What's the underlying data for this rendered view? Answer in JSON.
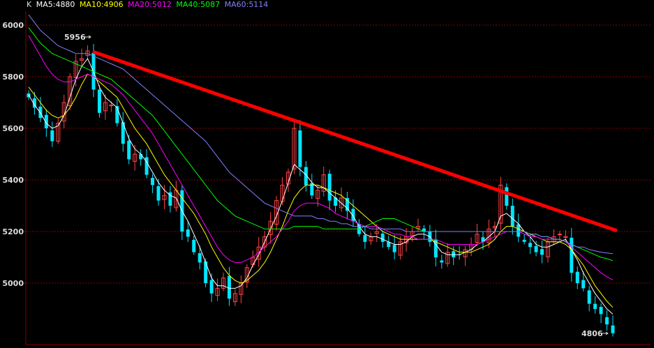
{
  "chart_data": {
    "type": "candlestick",
    "title": "K",
    "legend_position": "top-left",
    "grid": true,
    "ylim": [
      4750,
      6120
    ],
    "y_ticks": [
      5000,
      5200,
      5400,
      5600,
      5800,
      6000
    ],
    "y_tick_labels": [
      "5000",
      "5200",
      "5400",
      "5600",
      "5800",
      "6000"
    ],
    "moving_averages": [
      {
        "name": "MA5",
        "label": "MA5:4880",
        "value": 4880,
        "color": "#ffffff"
      },
      {
        "name": "MA10",
        "label": "MA10:4906",
        "value": 4906,
        "color": "#ffff00"
      },
      {
        "name": "MA20",
        "label": "MA20:5012",
        "value": 5012,
        "color": "#ff00ff"
      },
      {
        "name": "MA40",
        "label": "MA40:5087",
        "value": 5087,
        "color": "#00ff00"
      },
      {
        "name": "MA60",
        "label": "MA60:5114",
        "value": 5114,
        "color": "#8080ff"
      }
    ],
    "annotations": [
      {
        "label": "5956",
        "value": 5956,
        "arrow": "right"
      },
      {
        "label": "4806",
        "value": 4806,
        "arrow": "right"
      }
    ],
    "trendline": {
      "color": "#ff0000",
      "from_value": 5895,
      "to_value": 5205
    },
    "colors": {
      "up": "#ff4444",
      "down": "#00e5ff",
      "grid": "#8b0000",
      "axis": "#8b0000",
      "text": "#dddddd",
      "trend": "#ff0000"
    },
    "close_path": [
      5720,
      5680,
      5640,
      5600,
      5550,
      5620,
      5700,
      5800,
      5860,
      5870,
      5900,
      5750,
      5660,
      5700,
      5690,
      5620,
      5540,
      5480,
      5500,
      5480,
      5420,
      5380,
      5320,
      5340,
      5300,
      5360,
      5200,
      5180,
      5120,
      5080,
      5000,
      4960,
      4980,
      5020,
      4940,
      4960,
      5000,
      5060,
      5100,
      5140,
      5180,
      5240,
      5320,
      5380,
      5430,
      5600,
      5450,
      5380,
      5340,
      5360,
      5420,
      5320,
      5300,
      5330,
      5280,
      5240,
      5190,
      5160,
      5180,
      5200,
      5160,
      5140,
      5120,
      5160,
      5180,
      5200,
      5220,
      5200,
      5160,
      5100,
      5080,
      5120,
      5100,
      5110,
      5130,
      5150,
      5190,
      5160,
      5210,
      5220,
      5380,
      5300,
      5220,
      5180,
      5160,
      5140,
      5120,
      5110,
      5160,
      5180,
      5190,
      5180,
      5040,
      5000,
      4980,
      4920,
      4900,
      4880,
      4840,
      4806
    ],
    "ma5_path": [
      5730,
      5690,
      5660,
      5620,
      5600,
      5610,
      5650,
      5720,
      5790,
      5840,
      5870,
      5820,
      5760,
      5720,
      5700,
      5680,
      5620,
      5560,
      5520,
      5500,
      5470,
      5430,
      5390,
      5360,
      5340,
      5330,
      5280,
      5240,
      5190,
      5140,
      5080,
      5020,
      4990,
      4990,
      4980,
      4980,
      4990,
      5020,
      5070,
      5110,
      5160,
      5210,
      5260,
      5320,
      5390,
      5460,
      5440,
      5420,
      5390,
      5370,
      5370,
      5350,
      5330,
      5310,
      5290,
      5260,
      5220,
      5190,
      5180,
      5180,
      5170,
      5160,
      5150,
      5150,
      5160,
      5180,
      5190,
      5190,
      5180,
      5150,
      5120,
      5110,
      5110,
      5110,
      5120,
      5130,
      5150,
      5160,
      5180,
      5200,
      5260,
      5270,
      5250,
      5230,
      5200,
      5180,
      5150,
      5140,
      5140,
      5150,
      5160,
      5170,
      5130,
      5090,
      5040,
      5000,
      4960,
      4930,
      4900,
      4880
    ],
    "ma10_path": [
      5760,
      5730,
      5700,
      5670,
      5650,
      5640,
      5650,
      5680,
      5720,
      5770,
      5810,
      5800,
      5780,
      5760,
      5740,
      5720,
      5680,
      5640,
      5600,
      5570,
      5540,
      5500,
      5460,
      5420,
      5390,
      5360,
      5330,
      5300,
      5270,
      5230,
      5190,
      5140,
      5100,
      5060,
      5030,
      5010,
      5000,
      5010,
      5030,
      5050,
      5080,
      5120,
      5170,
      5220,
      5280,
      5330,
      5360,
      5380,
      5380,
      5380,
      5370,
      5360,
      5350,
      5340,
      5320,
      5300,
      5280,
      5260,
      5240,
      5220,
      5200,
      5190,
      5180,
      5170,
      5170,
      5170,
      5170,
      5170,
      5170,
      5160,
      5150,
      5140,
      5130,
      5120,
      5120,
      5120,
      5130,
      5140,
      5150,
      5170,
      5200,
      5220,
      5220,
      5210,
      5200,
      5190,
      5180,
      5170,
      5160,
      5160,
      5160,
      5150,
      5130,
      5100,
      5070,
      5030,
      4990,
      4960,
      4930,
      4906
    ],
    "ma20_path": [
      5960,
      5920,
      5880,
      5840,
      5810,
      5790,
      5780,
      5780,
      5790,
      5800,
      5810,
      5800,
      5790,
      5780,
      5770,
      5750,
      5730,
      5700,
      5670,
      5640,
      5610,
      5580,
      5540,
      5500,
      5460,
      5420,
      5380,
      5340,
      5300,
      5260,
      5220,
      5180,
      5140,
      5110,
      5090,
      5080,
      5080,
      5090,
      5100,
      5120,
      5140,
      5160,
      5180,
      5210,
      5240,
      5280,
      5300,
      5310,
      5310,
      5310,
      5300,
      5290,
      5270,
      5260,
      5250,
      5240,
      5230,
      5220,
      5220,
      5220,
      5210,
      5200,
      5190,
      5190,
      5180,
      5180,
      5170,
      5170,
      5170,
      5170,
      5160,
      5150,
      5150,
      5150,
      5150,
      5150,
      5150,
      5160,
      5170,
      5180,
      5190,
      5200,
      5200,
      5200,
      5190,
      5180,
      5180,
      5170,
      5170,
      5170,
      5170,
      5160,
      5140,
      5120,
      5100,
      5080,
      5060,
      5040,
      5025,
      5012
    ],
    "ma40_path": [
      5990,
      5960,
      5930,
      5910,
      5890,
      5880,
      5870,
      5860,
      5850,
      5840,
      5830,
      5820,
      5810,
      5800,
      5790,
      5770,
      5750,
      5730,
      5710,
      5690,
      5670,
      5650,
      5620,
      5590,
      5560,
      5530,
      5500,
      5470,
      5440,
      5410,
      5380,
      5350,
      5320,
      5300,
      5280,
      5260,
      5250,
      5240,
      5230,
      5220,
      5210,
      5210,
      5210,
      5210,
      5210,
      5220,
      5220,
      5220,
      5220,
      5220,
      5210,
      5210,
      5210,
      5210,
      5210,
      5210,
      5210,
      5220,
      5230,
      5240,
      5250,
      5250,
      5250,
      5240,
      5230,
      5220,
      5210,
      5200,
      5200,
      5200,
      5200,
      5200,
      5200,
      5200,
      5200,
      5200,
      5200,
      5200,
      5200,
      5200,
      5200,
      5200,
      5200,
      5200,
      5200,
      5190,
      5190,
      5180,
      5180,
      5170,
      5170,
      5160,
      5150,
      5140,
      5130,
      5120,
      5110,
      5100,
      5095,
      5087
    ],
    "ma60_path": [
      6040,
      6010,
      5980,
      5960,
      5940,
      5920,
      5910,
      5900,
      5890,
      5890,
      5890,
      5880,
      5870,
      5860,
      5850,
      5840,
      5830,
      5810,
      5790,
      5770,
      5750,
      5730,
      5710,
      5690,
      5670,
      5650,
      5630,
      5610,
      5590,
      5570,
      5550,
      5520,
      5490,
      5460,
      5430,
      5410,
      5390,
      5370,
      5350,
      5330,
      5310,
      5300,
      5290,
      5280,
      5270,
      5260,
      5260,
      5260,
      5260,
      5250,
      5250,
      5240,
      5240,
      5230,
      5230,
      5220,
      5220,
      5220,
      5210,
      5210,
      5210,
      5210,
      5210,
      5210,
      5200,
      5200,
      5200,
      5200,
      5200,
      5200,
      5200,
      5200,
      5200,
      5200,
      5200,
      5200,
      5200,
      5200,
      5200,
      5200,
      5200,
      5200,
      5200,
      5200,
      5200,
      5190,
      5190,
      5180,
      5180,
      5170,
      5170,
      5160,
      5150,
      5140,
      5140,
      5130,
      5125,
      5120,
      5117,
      5114
    ]
  }
}
